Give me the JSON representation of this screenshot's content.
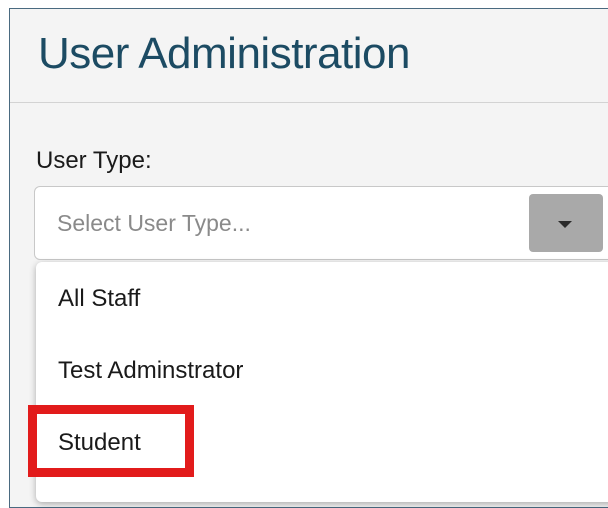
{
  "header": {
    "title": "User Administration"
  },
  "user_type": {
    "label": "User Type:",
    "placeholder": "Select User Type...",
    "options": [
      "All Staff",
      "Test Adminstrator",
      "Student"
    ]
  },
  "colors": {
    "title_text": "#1c4b63",
    "highlight": "#e21b1b",
    "toggle_background": "#a9a9a9",
    "panel_background": "#f4f4f4"
  },
  "icons": {
    "dropdown_toggle": "chevron-down-icon"
  }
}
